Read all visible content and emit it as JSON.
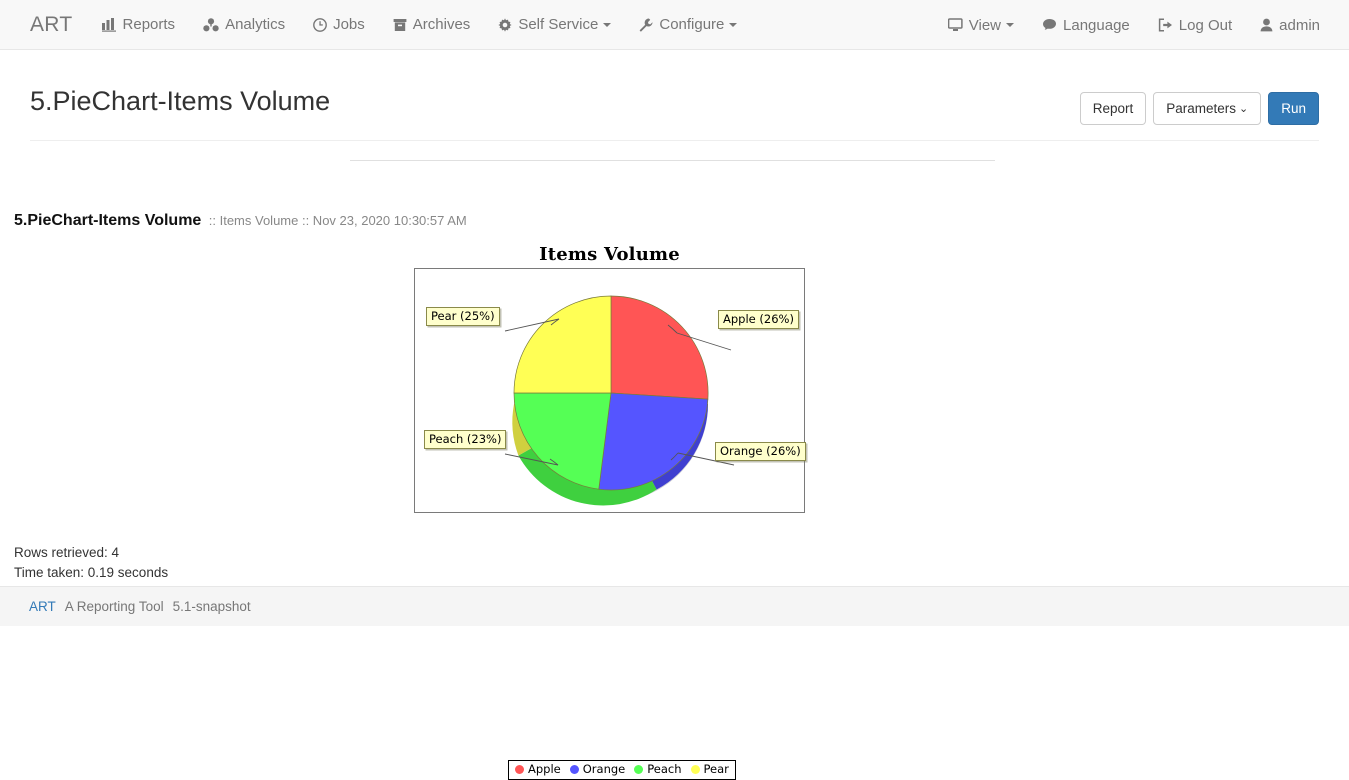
{
  "navbar": {
    "brand": "ART",
    "items": [
      {
        "label": "Reports",
        "icon": "bar-chart-icon"
      },
      {
        "label": "Analytics",
        "icon": "cubes-icon"
      },
      {
        "label": "Jobs",
        "icon": "clock-icon"
      },
      {
        "label": "Archives",
        "icon": "archive-icon"
      },
      {
        "label": "Self Service",
        "icon": "gear-icon",
        "caret": true
      },
      {
        "label": "Configure",
        "icon": "wrench-icon",
        "caret": true
      },
      {
        "label": "View",
        "icon": "desktop-icon",
        "caret": true
      },
      {
        "label": "Language",
        "icon": "comment-icon"
      },
      {
        "label": "Log Out",
        "icon": "sign-out-icon"
      }
    ],
    "user": {
      "label": "admin",
      "icon": "user-icon"
    }
  },
  "page": {
    "title": "5.PieChart-Items Volume",
    "buttons": {
      "report": "Report",
      "parameters": "Parameters",
      "parameters_caret": "⌄",
      "run": "Run"
    }
  },
  "report": {
    "name": "5.PieChart-Items Volume",
    "meta": ":: Items Volume :: Nov 23, 2020 10:30:57 AM",
    "rows_retrieved": "Rows retrieved: 4",
    "time_taken": "Time taken: 0.19 seconds"
  },
  "chart_data": {
    "type": "pie",
    "title": "Items Volume",
    "categories": [
      "Apple",
      "Orange",
      "Peach",
      "Pear"
    ],
    "values": [
      26,
      26,
      23,
      25
    ],
    "value_unit": "%",
    "labels": [
      "Apple (26%)",
      "Orange (26%)",
      "Peach (23%)",
      "Pear (25%)"
    ],
    "colors": [
      "#ff5555",
      "#5555ff",
      "#55ff55",
      "#ffff55"
    ],
    "legend": [
      "Apple",
      "Orange",
      "Peach",
      "Pear"
    ],
    "legend_position": "bottom",
    "three_d": true,
    "start_angle_deg": 90,
    "direction": "clockwise"
  },
  "footer": {
    "brand": "ART",
    "tagline": "A Reporting Tool",
    "version": "5.1-snapshot"
  }
}
